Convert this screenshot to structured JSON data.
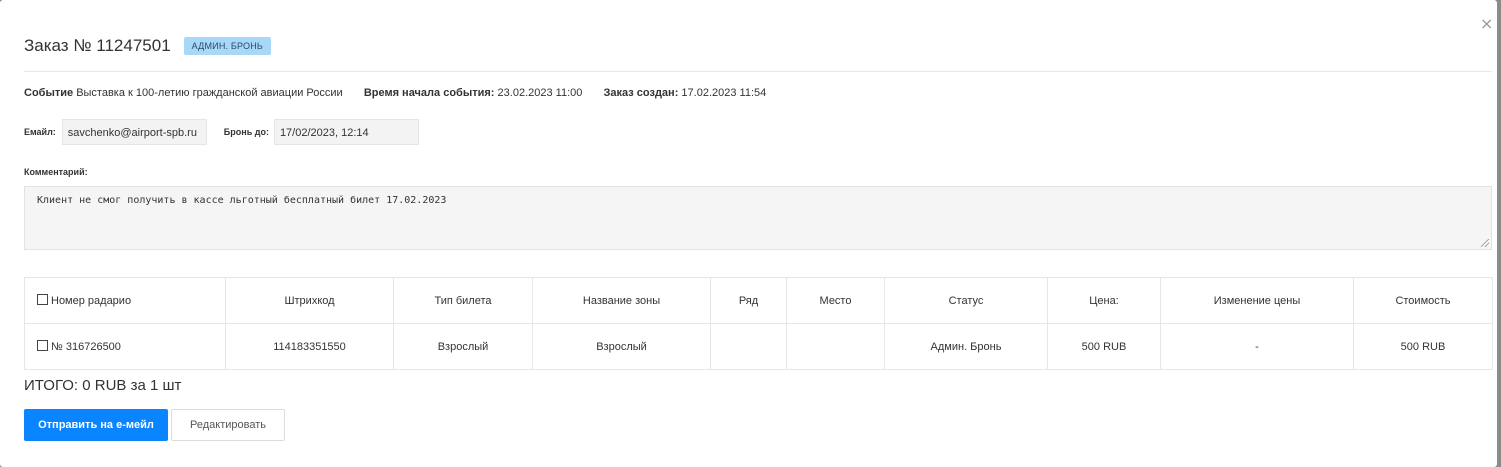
{
  "header": {
    "title": "Заказ № 11247501",
    "badge": "АДМИН. БРОНЬ",
    "close_icon": "×"
  },
  "meta": {
    "event_label": "Событие",
    "event_value": "Выставка к 100-летию гражданской авиации России",
    "start_label": "Время начала события:",
    "start_value": "23.02.2023 11:00",
    "created_label": "Заказ создан:",
    "created_value": "17.02.2023 11:54"
  },
  "fields": {
    "email_label": "Емайл:",
    "email_value": "savchenko@airport-spb.ru",
    "reserve_label": "Бронь до:",
    "reserve_value": "17/02/2023, 12:14"
  },
  "comment": {
    "label": "Комментарий:",
    "value": "Клиент не смог получить в кассе льготный бесплатный билет 17.02.2023"
  },
  "table": {
    "headers": [
      "Номер радарио",
      "Штрихкод",
      "Тип билета",
      "Название зоны",
      "Ряд",
      "Место",
      "Статус",
      "Цена:",
      "Изменение цены",
      "Стоимость"
    ],
    "rows": [
      [
        "№ 316726500",
        "114183351550",
        "Взрослый",
        "Взрослый",
        "",
        "",
        "Админ. Бронь",
        "500 RUB",
        "-",
        "500 RUB"
      ]
    ]
  },
  "total": "ИТОГО: 0 RUB за 1 шт",
  "buttons": {
    "send": "Отправить на е-мейл",
    "edit": "Редактировать"
  }
}
